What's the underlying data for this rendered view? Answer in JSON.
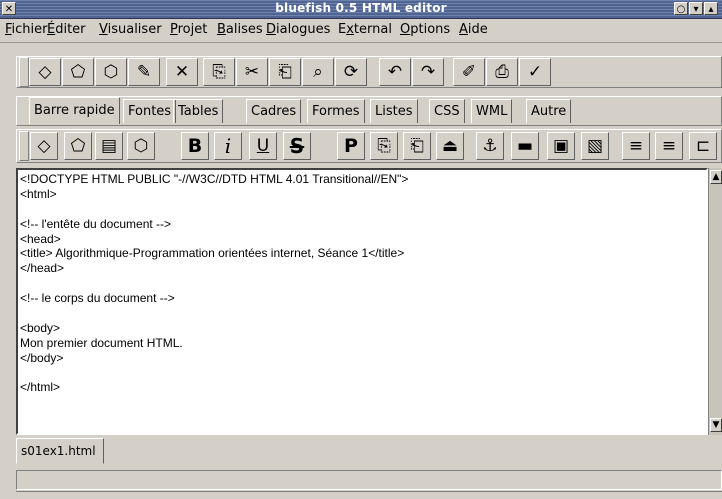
{
  "window": {
    "title": "bluefish 0.5 HTML editor",
    "close_glyph": "✕",
    "btn_glyphs": [
      "○",
      "▾",
      "▴"
    ]
  },
  "menu": [
    {
      "pre": "",
      "u": "F",
      "post": "ichier"
    },
    {
      "pre": "",
      "u": "É",
      "post": "diter"
    },
    {
      "pre": "",
      "u": "V",
      "post": "isualiser"
    },
    {
      "pre": "",
      "u": "P",
      "post": "rojet"
    },
    {
      "pre": "",
      "u": "B",
      "post": "alises"
    },
    {
      "pre": "",
      "u": "D",
      "post": "ialogues"
    },
    {
      "pre": "E",
      "u": "x",
      "post": "ternal"
    },
    {
      "pre": "",
      "u": "O",
      "post": "ptions"
    },
    {
      "pre": "",
      "u": "A",
      "post": "ide"
    }
  ],
  "toolbar_main": [
    {
      "name": "new-file-icon",
      "glyph": "◇"
    },
    {
      "name": "open-file-icon",
      "glyph": "⬠"
    },
    {
      "name": "save-icon",
      "glyph": "⬡"
    },
    {
      "name": "save-as-icon",
      "glyph": "✎"
    },
    {
      "name": "close-file-icon",
      "glyph": "✕"
    },
    {
      "name": "copy-icon",
      "glyph": "⎘"
    },
    {
      "name": "cut-icon",
      "glyph": "✂"
    },
    {
      "name": "paste-icon",
      "glyph": "⎗"
    },
    {
      "name": "search-icon",
      "glyph": "⌕"
    },
    {
      "name": "replace-icon",
      "glyph": "⟳"
    },
    {
      "name": "undo-icon",
      "glyph": "↶"
    },
    {
      "name": "redo-icon",
      "glyph": "↷"
    },
    {
      "name": "preferences-icon",
      "glyph": "✐"
    },
    {
      "name": "print-icon",
      "glyph": "⎙"
    },
    {
      "name": "spellcheck-icon",
      "glyph": "✓"
    }
  ],
  "tabs": [
    "Barre rapide",
    "Fontes",
    "Tables",
    "Cadres",
    "Formes",
    "Listes",
    "CSS",
    "WML",
    "Autre"
  ],
  "toolbar_quick": [
    {
      "name": "quickstart-icon",
      "glyph": "◇"
    },
    {
      "name": "body-icon",
      "glyph": "⬠"
    },
    {
      "name": "comment-icon",
      "glyph": "▤"
    },
    {
      "name": "document-icon",
      "glyph": "⬡"
    },
    {
      "name": "bold-icon",
      "glyph": "B"
    },
    {
      "name": "italic-icon",
      "glyph": "i"
    },
    {
      "name": "underline-icon",
      "glyph": "U"
    },
    {
      "name": "strikethrough-icon",
      "glyph": "S"
    },
    {
      "name": "paragraph-icon",
      "glyph": "P"
    },
    {
      "name": "break-icon",
      "glyph": "⎘"
    },
    {
      "name": "break-clear-icon",
      "glyph": "⎗"
    },
    {
      "name": "nbsp-icon",
      "glyph": "⏏"
    },
    {
      "name": "anchor-icon",
      "glyph": "⚓"
    },
    {
      "name": "horizontal-rule-icon",
      "glyph": "▬"
    },
    {
      "name": "image-icon",
      "glyph": "▣"
    },
    {
      "name": "thumbnail-icon",
      "glyph": "▧"
    },
    {
      "name": "align-left-icon",
      "glyph": "≡"
    },
    {
      "name": "align-center-icon",
      "glyph": "≡"
    },
    {
      "name": "more-icon",
      "glyph": "⊏"
    }
  ],
  "editor_lines": [
    "<!DOCTYPE HTML PUBLIC \"-//W3C//DTD HTML 4.01 Transitional//EN\">",
    "<html>",
    "",
    "<!-- l'entête du document -->",
    "<head>",
    "<title> Algorithmique-Programmation orientées internet, Séance 1</title>",
    "</head>",
    "",
    "<!-- le corps du document -->",
    "",
    "<body>",
    "Mon premier document HTML.",
    "</body>",
    "",
    "</html>"
  ],
  "file_tab": "s01ex1.html",
  "status": ""
}
